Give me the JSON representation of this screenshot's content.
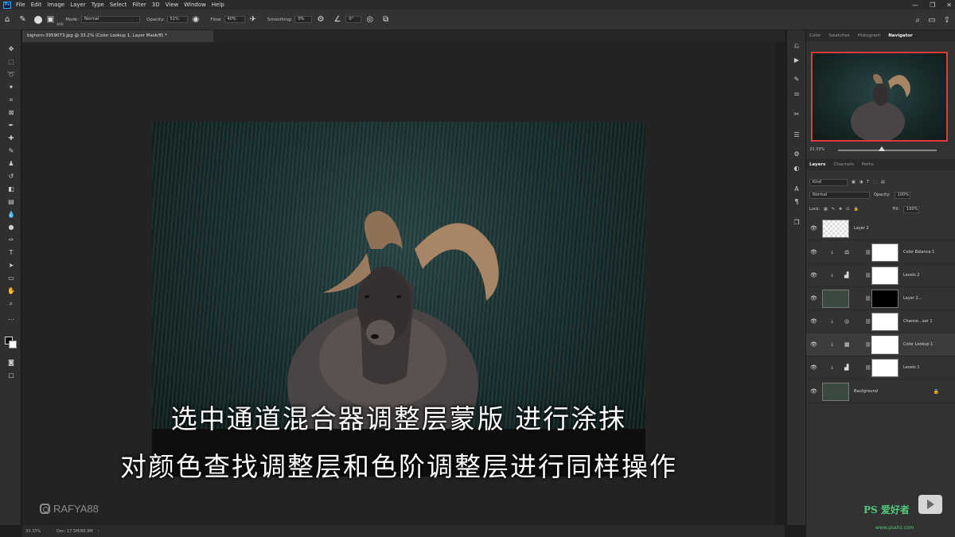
{
  "menubar": {
    "logo": "Ps",
    "items": [
      "File",
      "Edit",
      "Image",
      "Layer",
      "Type",
      "Select",
      "Filter",
      "3D",
      "View",
      "Window",
      "Help"
    ],
    "window_controls": [
      "—",
      "❐",
      "✕"
    ]
  },
  "options": {
    "brush_size": "400",
    "mode_label": "Mode:",
    "mode_value": "Normal",
    "opacity_label": "Opacity:",
    "opacity_value": "51%",
    "flow_label": "Flow:",
    "flow_value": "40%",
    "smoothing_label": "Smoothing:",
    "smoothing_value": "0%",
    "angle_value": "0°"
  },
  "document": {
    "tab_title": "bighorn-3959073.jpg @ 33.2% (Color Lookup 1, Layer Mask/8) *"
  },
  "status": {
    "zoom": "33.33%",
    "doc": "Doc: 17.5M/66.9M"
  },
  "subtitles": {
    "line1": "选中通道混合器调整层蒙版 进行涂抹",
    "line2": "对颜色查找调整层和色阶调整层进行同样操作"
  },
  "watermark": "RAFYA88",
  "panel": {
    "top_tabs": [
      "Color",
      "Swatches",
      "Histogram",
      "Navigator"
    ],
    "nav_zoom": "33.33%",
    "layer_tabs": [
      "Layers",
      "Channels",
      "Paths"
    ],
    "kind_filter": "Kind",
    "blend_mode": "Normal",
    "opacity_label": "Opacity:",
    "opacity_value": "100%",
    "lock_label": "Lock:",
    "fill_label": "Fill:",
    "fill_value": "100%",
    "layers": [
      {
        "name": "Layer 2"
      },
      {
        "name": "Color Balance 1"
      },
      {
        "name": "Levels 2"
      },
      {
        "name": "Layer 2..."
      },
      {
        "name": "Channe...xer 1"
      },
      {
        "name": "Color Lookup 1"
      },
      {
        "name": "Levels 1"
      },
      {
        "name": "Background"
      }
    ]
  },
  "site": {
    "logo": "PS 爱好者",
    "url": "www.psahz.com"
  }
}
